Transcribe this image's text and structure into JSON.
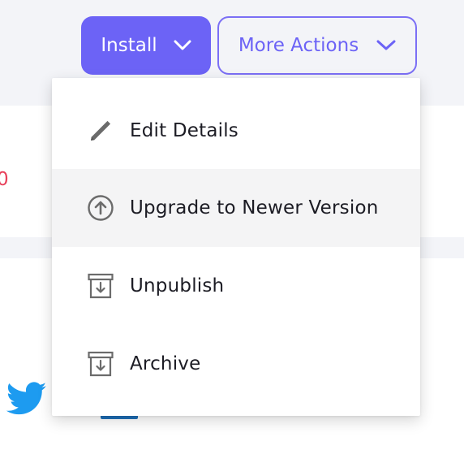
{
  "header": {
    "install_label": "Install",
    "more_actions_label": "More Actions"
  },
  "menu": {
    "items": [
      {
        "label": "Edit Details",
        "icon": "pencil-icon"
      },
      {
        "label": "Upgrade to Newer Version",
        "icon": "arrow-up-circle-icon"
      },
      {
        "label": "Unpublish",
        "icon": "archive-box-icon"
      },
      {
        "label": "Archive",
        "icon": "archive-box-icon"
      }
    ],
    "hovered_index": 1
  },
  "background": {
    "partial_value": "0"
  },
  "colors": {
    "accent": "#6c63f6",
    "page_bg": "#f3f4f8",
    "hover_bg": "#f4f4f5",
    "error_red": "#e8405a",
    "twitter_blue": "#1d9bf0"
  }
}
